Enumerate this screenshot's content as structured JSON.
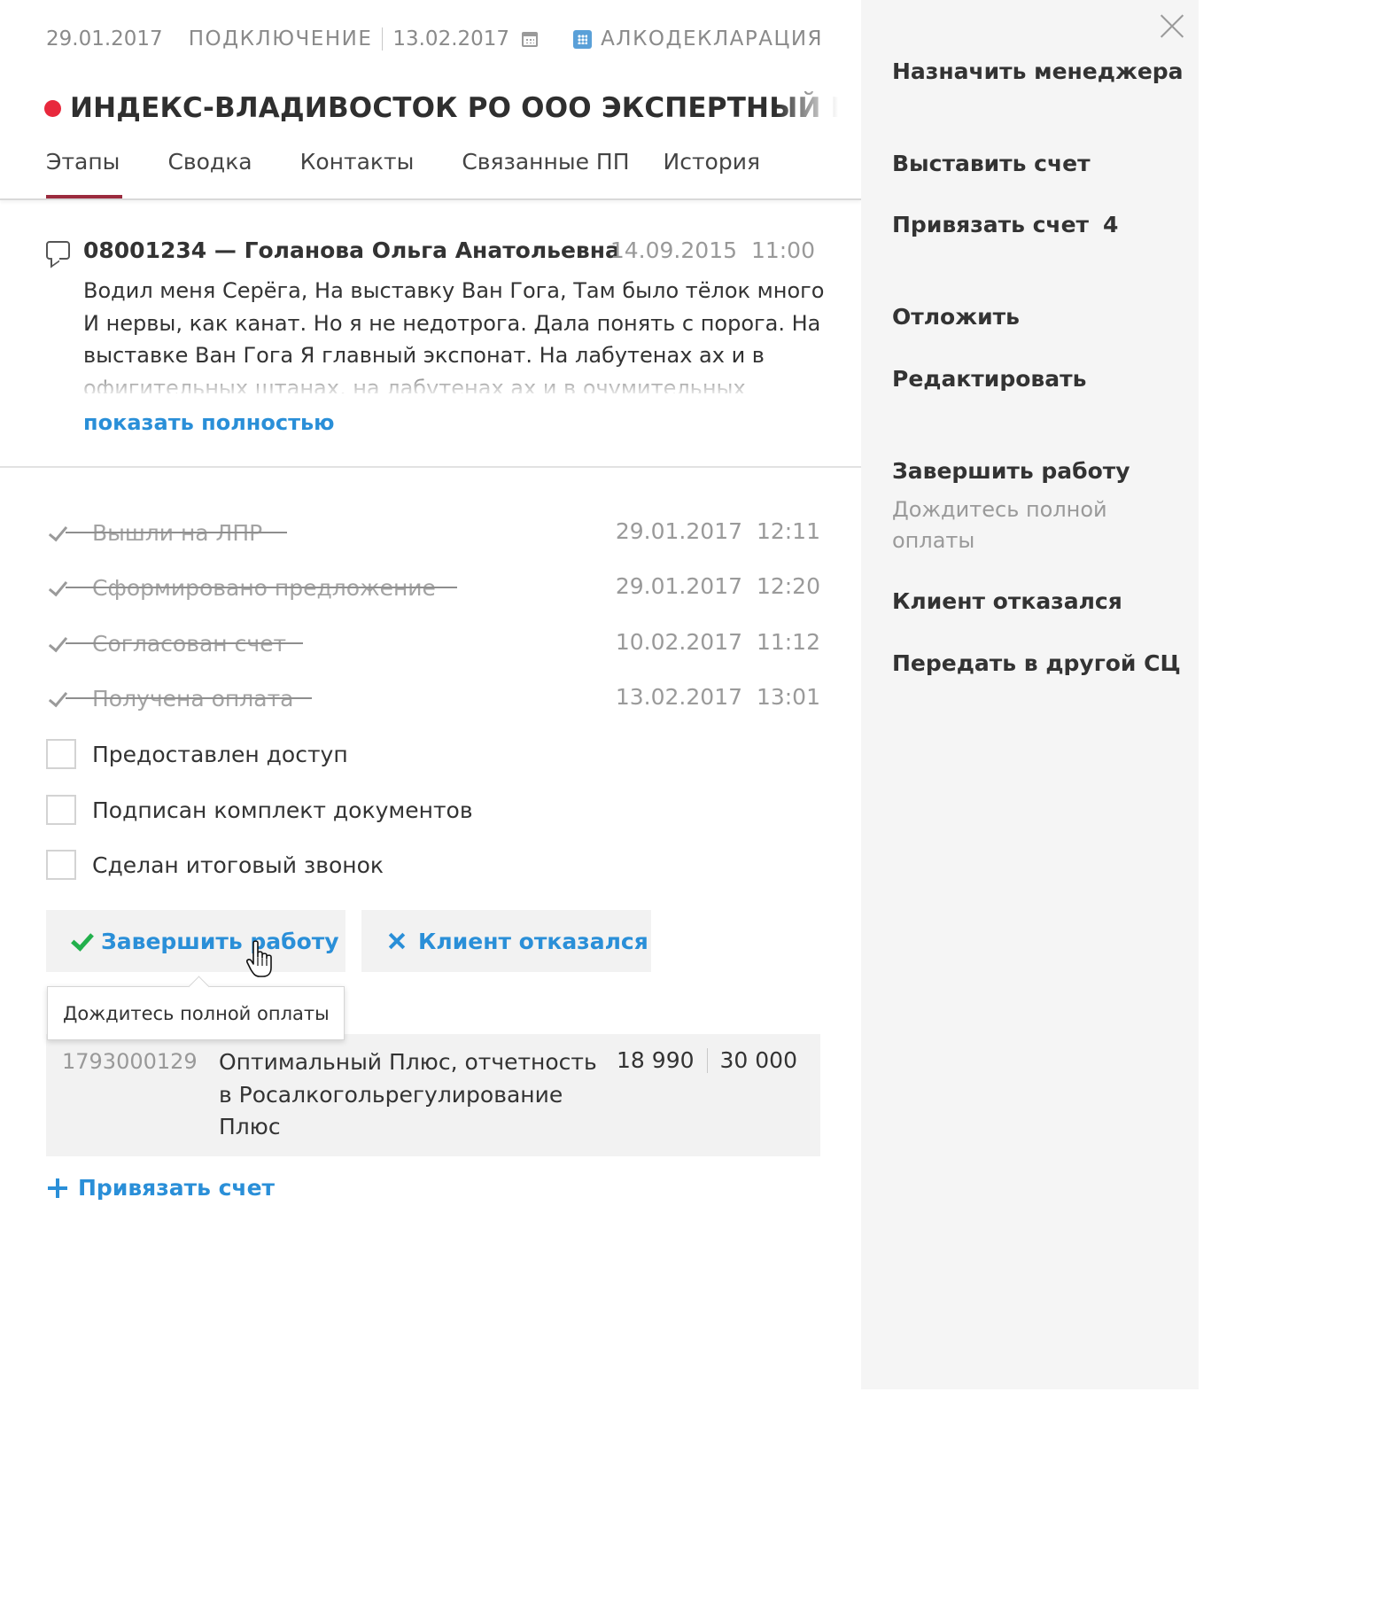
{
  "header": {
    "date": "29.01.2017",
    "stage": "ПОДКЛЮЧЕНИЕ",
    "stage_date": "13.02.2017",
    "product": "АЛКОДЕКЛАРАЦИЯ",
    "client_name": "ИНДЕКС-ВЛАДИВОСТОК РО ООО ЭКСПЕРТНЫЙ ЦЕНТР ИН",
    "status_color": "#e8283c"
  },
  "tabs": [
    {
      "label": "Этапы",
      "active": true
    },
    {
      "label": "Сводка"
    },
    {
      "label": "Контакты"
    },
    {
      "label": "Связанные ПП"
    },
    {
      "label": "История"
    }
  ],
  "comment": {
    "author": "08001234 — Голанова Ольга Анатольевна",
    "date": "14.09.2015 11:00",
    "text": "Водил меня Серёга, На выставку Ван Гога, Там было тёлок много И нервы, как канат. Но я не недотрога. Дала понять с порога. На выставке Ван Гога Я главный экспонат. На лабутенах ах и в офигительных штанах, на лабутенах ах и в очумительных",
    "show_full": "показать полностью"
  },
  "stages_done": [
    {
      "label": "Вышли на ЛПР",
      "date": "29.01.2017 12:11"
    },
    {
      "label": "Сформировано предложение",
      "date": "29.01.2017 12:20"
    },
    {
      "label": "Согласован счет",
      "date": "10.02.2017 11:12"
    },
    {
      "label": "Получена оплата",
      "date": "13.02.2017 13:01"
    }
  ],
  "stages_todo": [
    {
      "label": "Предоставлен доступ"
    },
    {
      "label": "Подписан комплект документов"
    },
    {
      "label": "Сделан итоговый звонок"
    }
  ],
  "actions": {
    "finish": "Завершить работу",
    "refuse": "Клиент отказался",
    "tooltip": "Дождитесь полной оплаты"
  },
  "invoice": {
    "number": "1793000129",
    "name": "Оптимальный Плюс, отчетность в Росалкогольрегулирование Плюс",
    "paid": "18 990",
    "total": "30 000"
  },
  "attach_invoice": "Привязать счет",
  "sidebar": {
    "assign_manager": "Назначить менеджера",
    "issue_invoice": "Выставить счет",
    "attach_invoice": "Привязать счет",
    "attach_count": "4",
    "postpone": "Отложить",
    "edit": "Редактировать",
    "finish": "Завершить работу",
    "finish_hint": "Дождитесь полной оплаты",
    "refused": "Клиент отказался",
    "transfer": "Передать в другой СЦ"
  },
  "colors": {
    "accent": "#2a8fd8",
    "tab_underline": "#9b2b3e",
    "ok": "#22b04c"
  }
}
